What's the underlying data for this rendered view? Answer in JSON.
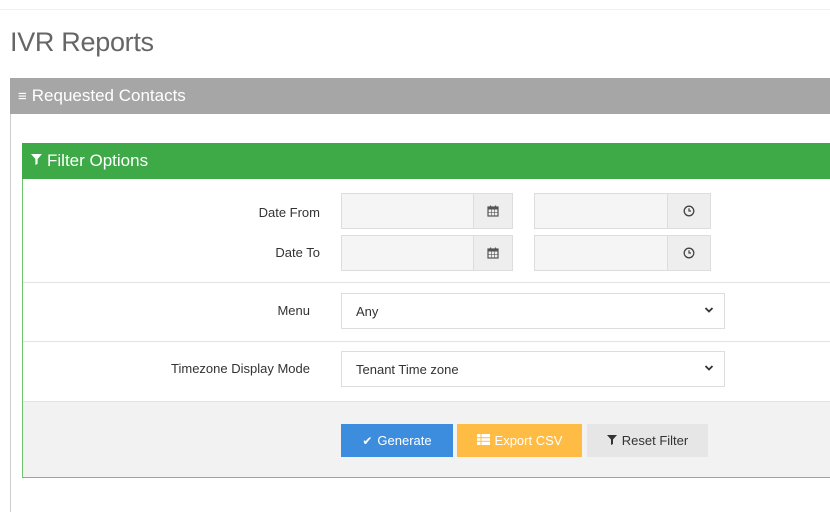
{
  "page": {
    "title": "IVR Reports"
  },
  "panel": {
    "title": "Requested Contacts",
    "icon": "bars-icon"
  },
  "filter": {
    "title": "Filter Options",
    "icon": "filter-icon",
    "date_from_label": "Date From",
    "date_to_label": "Date To",
    "date_from_value": "",
    "date_from_time_value": "",
    "date_to_value": "",
    "date_to_time_value": "",
    "menu_label": "Menu",
    "menu_value": "Any",
    "timezone_label": "Timezone Display Mode",
    "timezone_value": "Tenant Time zone"
  },
  "buttons": {
    "generate": "Generate",
    "export": "Export CSV",
    "reset": "Reset Filter"
  },
  "colors": {
    "panel_header": "#a6a6a6",
    "filter_header": "#3daa47",
    "generate": "#3c8dde",
    "export": "#ffbc45",
    "reset": "#e6e6e6"
  }
}
